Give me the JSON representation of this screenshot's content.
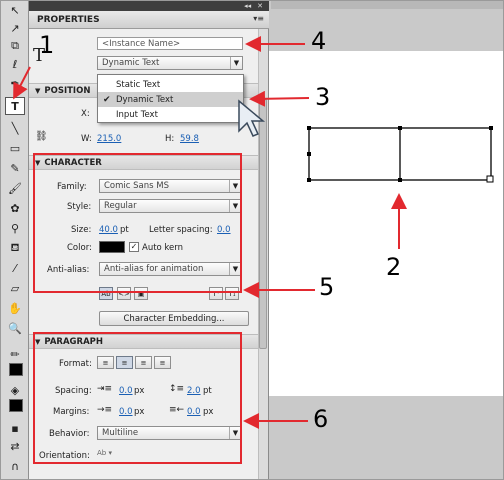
{
  "colors": {
    "accent": "#e2292f",
    "link": "#1a5fb4",
    "stage_gray": "#c9c9c9"
  },
  "tools": {
    "active": "text-tool"
  },
  "window": {
    "collapse_label": "◂◂",
    "close_label": "✕"
  },
  "panel": {
    "title": "PROPERTIES",
    "instance_name_placeholder": "<Instance Name>",
    "text_type": {
      "selected": "Dynamic Text",
      "options": [
        "Static Text",
        "Dynamic Text",
        "Input Text"
      ]
    }
  },
  "position": {
    "heading": "POSITION",
    "x_label": "X:",
    "w_label": "W:",
    "w_value": "215.0",
    "h_label": "H:",
    "h_value": "59.8"
  },
  "character": {
    "heading": "CHARACTER",
    "family_label": "Family:",
    "family_value": "Comic Sans MS",
    "style_label": "Style:",
    "style_value": "Regular",
    "size_label": "Size:",
    "size_value": "40.0",
    "size_unit": "pt",
    "letter_spacing_label": "Letter spacing:",
    "letter_spacing_value": "0.0",
    "color_label": "Color:",
    "color_value": "#000000",
    "auto_kern_label": "Auto kern",
    "auto_kern_checked": true,
    "anti_alias_label": "Anti-alias:",
    "anti_alias_value": "Anti-alias for animation",
    "embedding_button": "Character Embedding..."
  },
  "paragraph": {
    "heading": "PARAGRAPH",
    "format_label": "Format:",
    "spacing_label": "Spacing:",
    "spacing_indent_value": "0.0",
    "spacing_indent_unit": "px",
    "spacing_line_value": "2.0",
    "spacing_line_unit": "pt",
    "margins_label": "Margins:",
    "margin_left_value": "0.0",
    "margin_left_unit": "px",
    "margin_right_value": "0.0",
    "margin_right_unit": "px",
    "behavior_label": "Behavior:",
    "behavior_value": "Multiline",
    "orientation_label": "Orientation:"
  },
  "callouts": [
    "1",
    "2",
    "3",
    "4",
    "5",
    "6"
  ],
  "text_tool_glyph": "T"
}
